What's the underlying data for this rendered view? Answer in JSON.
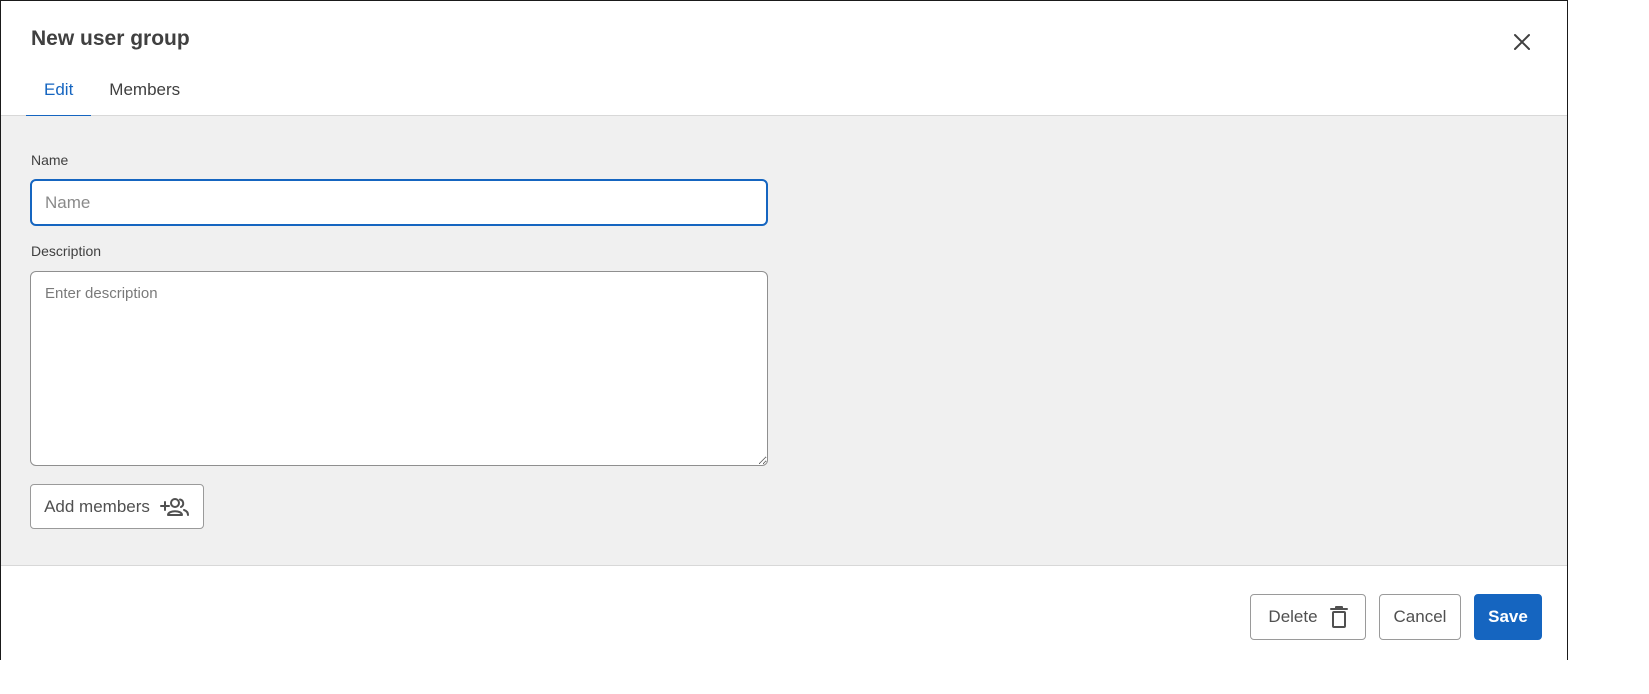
{
  "dialog": {
    "title": "New user group",
    "tabs": [
      {
        "label": "Edit",
        "active": true
      },
      {
        "label": "Members",
        "active": false
      }
    ]
  },
  "form": {
    "name_label": "Name",
    "name_value": "",
    "name_placeholder": "Name",
    "description_label": "Description",
    "description_value": "",
    "description_placeholder": "Enter description",
    "add_members_label": "Add members"
  },
  "footer": {
    "delete_label": "Delete",
    "cancel_label": "Cancel",
    "save_label": "Save"
  },
  "icons": {
    "close": "close-icon",
    "add_members": "add-group-icon",
    "delete": "trash-icon"
  },
  "colors": {
    "accent": "#1565c0",
    "body_background": "#f0f0f0"
  }
}
